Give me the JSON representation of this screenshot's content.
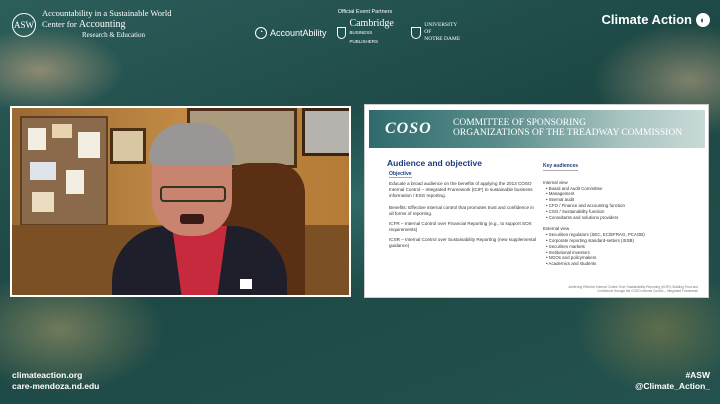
{
  "header": {
    "left_logo": {
      "seal_text": "ASW",
      "line1": "Accountability in a Sustainable World",
      "line2_prefix": "Center for",
      "line2_main": "Accounting",
      "line3": "Research & Education"
    },
    "partners_label": "Official Event Partners",
    "partners": {
      "accountability": "AccountAbility",
      "cambridge": "Cambridge",
      "cambridge_sub": "BUSINESS PUBLISHERS",
      "notre_dame_1": "UNIVERSITY OF",
      "notre_dame_2": "NOTRE DAME"
    },
    "brand": "Climate Action"
  },
  "slide": {
    "logo": "COSO",
    "org_line1": "Committee of Sponsoring",
    "org_line2": "Organizations of the Treadway Commission",
    "title": "Audience and objective",
    "objective_heading": "Objective",
    "objective_text": "Educate a broad audience on the benefits of applying the 2013 COSO Internal Control – Integrated Framework (ICIF) to sustainable business information / ESG reporting.",
    "benefits_text": "Benefits: Effective internal control that promotes trust and confidence in all forms of reporting.",
    "icfr_text": "ICFR – Internal Control over Financial Reporting (e.g., to support SOX requirements)",
    "icsr_text": "ICSR – Internal Control over Sustainability Reporting (new supplemental guidance)",
    "audiences_heading": "Key audiences",
    "internal_label": "Internal view",
    "internal_items": [
      "Board and Audit Committee",
      "Management",
      "Internal audit",
      "CFO / Finance and accounting function",
      "CSO / Sustainability function",
      "Consultants and solutions providers"
    ],
    "external_label": "External view",
    "external_items": [
      "Securities regulators (SEC, EC/EFRAG, PCAOB)",
      "Corporate reporting standard-setters (ISSB)",
      "Securities markets",
      "Institutional investors",
      "NGOs and policymakers",
      "Academics and students"
    ],
    "footer": "Achieving Effective Internal Control Over Sustainability Reporting (ICSR): Building Trust and Confidence through the COSO Internal Control – Integrated Framework"
  },
  "footer": {
    "url1": "climateaction.org",
    "url2": "care-mendoza.nd.edu",
    "hashtag": "#ASW",
    "handle": "@Climate_Action_"
  }
}
